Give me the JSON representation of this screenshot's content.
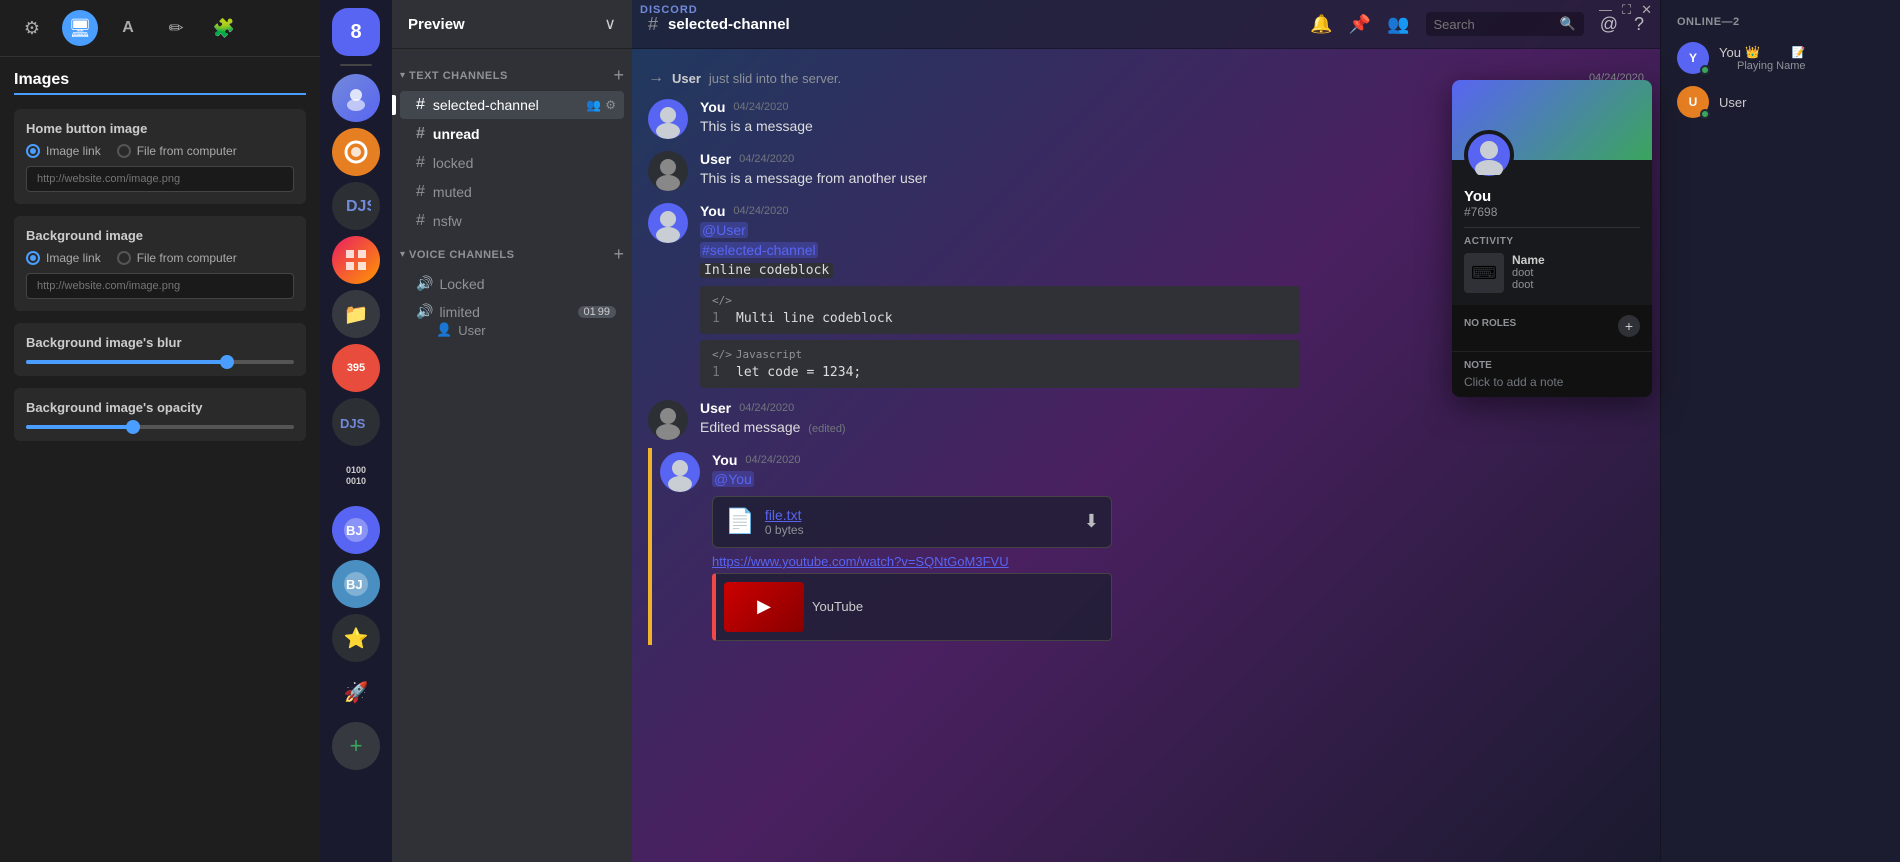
{
  "settings": {
    "title": "Images",
    "tools": [
      {
        "id": "gear",
        "icon": "⚙",
        "active": false
      },
      {
        "id": "monitor",
        "icon": "🖥",
        "active": true
      },
      {
        "id": "text",
        "icon": "A",
        "active": false
      },
      {
        "id": "brush",
        "icon": "✏",
        "active": false
      },
      {
        "id": "puzzle",
        "icon": "🧩",
        "active": false
      }
    ],
    "sections": [
      {
        "id": "home-button-image",
        "title": "Home button image",
        "imageLink": {
          "label": "Image link",
          "checked": true
        },
        "fileFromComputer": {
          "label": "File from computer",
          "checked": false
        },
        "placeholder": "http://website.com/image.png"
      },
      {
        "id": "background-image",
        "title": "Background image",
        "imageLink": {
          "label": "Image link",
          "checked": true
        },
        "fileFromComputer": {
          "label": "File from computer",
          "checked": false
        },
        "placeholder": "http://website.com/image.png"
      }
    ],
    "blur": {
      "title": "Background image's blur",
      "value": 75
    },
    "opacity": {
      "title": "Background image's opacity",
      "value": 40
    }
  },
  "discord": {
    "logo": "DISCORD",
    "titleBar": {
      "minimize": "—",
      "maximize": "⛶",
      "close": "✕"
    },
    "activeServer": {
      "number": "8"
    },
    "serverHeader": {
      "name": "Preview",
      "chevron": "∨"
    },
    "textChannels": {
      "category": "TEXT CHANNELS",
      "channels": [
        {
          "id": "selected-channel",
          "name": "selected-channel",
          "active": true
        },
        {
          "id": "unread",
          "name": "unread",
          "unread": true
        },
        {
          "id": "locked",
          "name": "locked"
        },
        {
          "id": "muted",
          "name": "muted"
        },
        {
          "id": "nsfw",
          "name": "nsfw"
        }
      ]
    },
    "voiceChannels": {
      "category": "VOICE CHANNELS",
      "channels": [
        {
          "id": "locked-voice",
          "name": "Locked"
        },
        {
          "id": "limited",
          "name": "limited",
          "badges": [
            "01",
            "99"
          ],
          "users": [
            "User"
          ]
        }
      ]
    },
    "chatHeader": {
      "channel": "selected-channel",
      "hash": "#"
    },
    "headerIcons": {
      "bell": "🔔",
      "pin": "📌",
      "members": "👥",
      "search": "Search",
      "at": "@",
      "help": "?"
    },
    "messages": [
      {
        "type": "system",
        "text": "just slid into the server.",
        "user": "User",
        "date": "04/24/2020"
      },
      {
        "type": "message",
        "author": "You",
        "date": "04/24/2020",
        "avatarColor": "#5865f2",
        "text": "This is a message"
      },
      {
        "type": "message",
        "author": "User",
        "date": "04/24/2020",
        "avatarColor": "#2c2f33",
        "text": "This is a message from another user"
      },
      {
        "type": "message",
        "author": "You",
        "date": "04/24/2020",
        "avatarColor": "#5865f2",
        "parts": [
          {
            "kind": "mention",
            "text": "@User"
          },
          {
            "kind": "text",
            "text": "\n"
          },
          {
            "kind": "channel-mention",
            "text": "#selected-channel"
          },
          {
            "kind": "text",
            "text": "\n"
          },
          {
            "kind": "inline-code",
            "text": "Inline codeblock"
          }
        ],
        "codeBlocks": [
          {
            "lang": "",
            "lines": [
              {
                "num": "1",
                "code": "Multi line codeblock"
              }
            ]
          },
          {
            "lang": "Javascript",
            "lines": [
              {
                "num": "1",
                "code": "let code = 1234;"
              }
            ]
          }
        ]
      },
      {
        "type": "message",
        "author": "User",
        "date": "04/24/2020",
        "avatarColor": "#2c2f33",
        "text": "Edited message",
        "edited": true
      },
      {
        "type": "message",
        "author": "You",
        "date": "04/24/2020",
        "avatarColor": "#5865f2",
        "highlighted": true,
        "parts": [
          {
            "kind": "mention-self",
            "text": "@You"
          }
        ],
        "file": {
          "name": "file.txt",
          "size": "0 bytes"
        },
        "link": "https://www.youtube.com/watch?v=SQNtGoM3FVU",
        "embedTitle": "YouTube"
      }
    ],
    "memberList": {
      "onlineCount": "ONLINE—2",
      "members": [
        {
          "id": "you",
          "name": "You",
          "tag": "👑",
          "status": "online",
          "extra": "📝",
          "playing": "Playing Name"
        },
        {
          "id": "user",
          "name": "User",
          "status": "online"
        }
      ]
    },
    "profilePopup": {
      "username": "You",
      "discriminator": "#7698",
      "activity": {
        "title": "ACTIVITY",
        "name": "Name",
        "detail1": "doot",
        "detail2": "doot"
      },
      "roles": {
        "title": "NO ROLES"
      },
      "note": {
        "title": "NOTE",
        "placeholder": "Click to add a note"
      }
    }
  }
}
